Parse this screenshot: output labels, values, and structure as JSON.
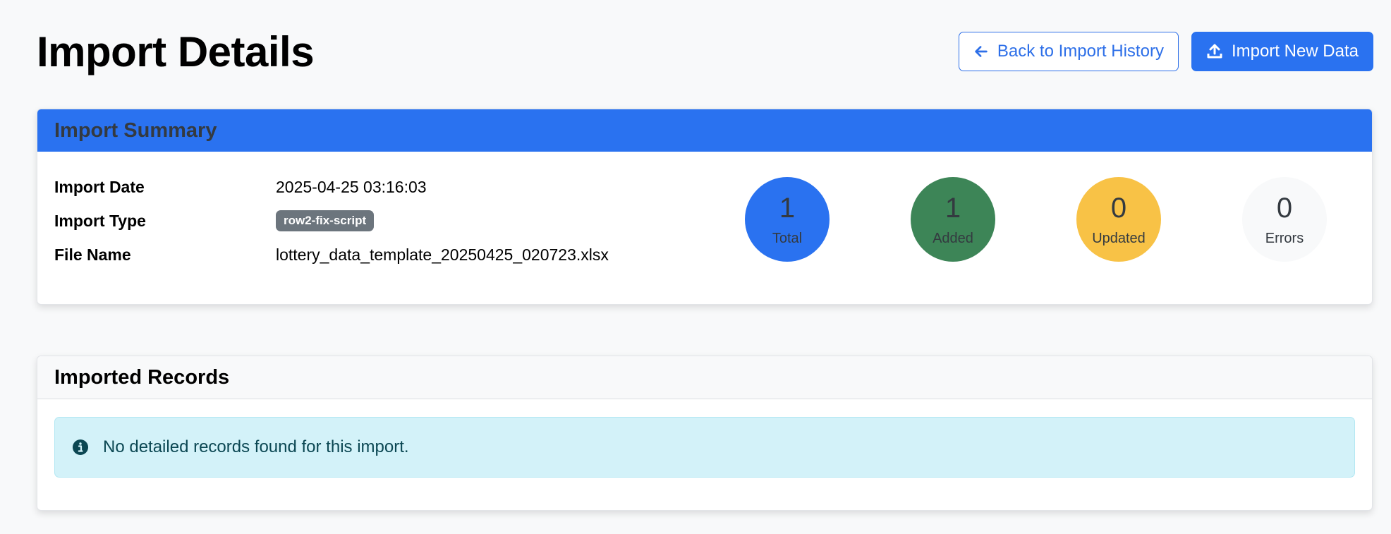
{
  "page": {
    "title": "Import Details"
  },
  "actions": {
    "back_label": "Back to Import History",
    "import_new_label": "Import New Data"
  },
  "summary": {
    "header": "Import Summary",
    "fields": [
      {
        "label": "Import Date",
        "value": "2025-04-25 03:16:03"
      },
      {
        "label": "Import Type",
        "value": "row2-fix-script"
      },
      {
        "label": "File Name",
        "value": "lottery_data_template_20250425_020723.xlsx"
      }
    ],
    "stats": [
      {
        "value": "1",
        "label": "Total",
        "color": "#2a72f0"
      },
      {
        "value": "1",
        "label": "Added",
        "color": "#3d8557"
      },
      {
        "value": "0",
        "label": "Updated",
        "color": "#f8c246"
      },
      {
        "value": "0",
        "label": "Errors",
        "color": "#f8f9fa"
      }
    ]
  },
  "records": {
    "header": "Imported Records",
    "empty_message": "No detailed records found for this import."
  },
  "colors": {
    "primary": "#2a72f0",
    "info_bg": "#d3f2f9",
    "badge": "#6c757d"
  },
  "icons": {
    "back": "arrow-left-icon",
    "import": "upload-icon",
    "info": "info-circle-icon"
  }
}
